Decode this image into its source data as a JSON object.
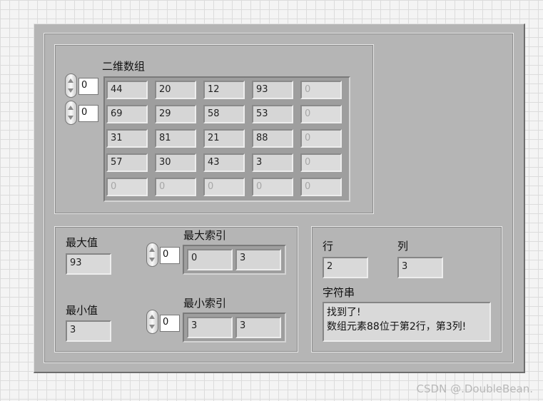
{
  "array_2d": {
    "label": "二维数组",
    "row_index": "0",
    "col_index": "0",
    "rows": [
      [
        "44",
        "20",
        "12",
        "93",
        "0"
      ],
      [
        "69",
        "29",
        "58",
        "53",
        "0"
      ],
      [
        "31",
        "81",
        "21",
        "88",
        "0"
      ],
      [
        "57",
        "30",
        "43",
        "3",
        "0"
      ],
      [
        "0",
        "0",
        "0",
        "0",
        "0"
      ]
    ]
  },
  "max": {
    "value_label": "最大值",
    "value": "93",
    "index_label": "最大索引",
    "index_spin": "0",
    "index": [
      "0",
      "3"
    ]
  },
  "min": {
    "value_label": "最小值",
    "value": "3",
    "index_label": "最小索引",
    "index_spin": "0",
    "index": [
      "3",
      "3"
    ]
  },
  "result": {
    "row_label": "行",
    "row_value": "2",
    "col_label": "列",
    "col_value": "3",
    "string_label": "字符串",
    "string_lines": [
      "找到了!",
      "数组元素88位于第2行，第3列!"
    ]
  },
  "watermark": "CSDN @.DoubleBean."
}
